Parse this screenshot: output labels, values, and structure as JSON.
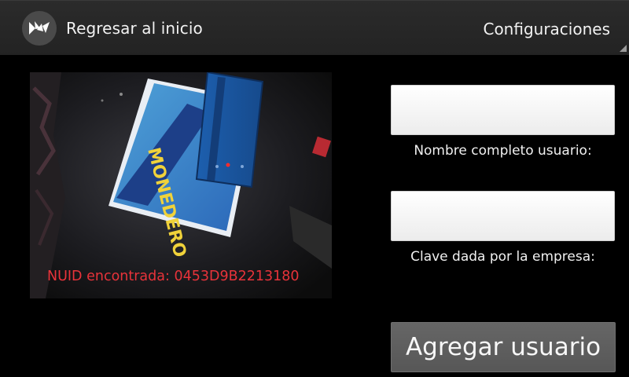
{
  "action_bar": {
    "title": "Regresar al inicio",
    "settings_label": "Configuraciones"
  },
  "camera": {
    "nuid_text": "NUID encontrada: 0453D9B2213180",
    "card_print_text": "MONEDERO",
    "nuid_color": "#e8333a"
  },
  "form": {
    "name_field": {
      "value": "",
      "placeholder": ""
    },
    "name_label": "Nombre completo usuario:",
    "key_field": {
      "value": "",
      "placeholder": ""
    },
    "key_label": "Clave dada por la empresa:",
    "submit_label": "Agregar usuario"
  },
  "colors": {
    "background": "#000000",
    "action_bar": "#2b2b2b",
    "button": "#5f5f5f",
    "field": "#f5f5f5"
  },
  "icons": {
    "logo": "kivy-logo-icon",
    "overflow_corner": "corner-triangle-icon"
  }
}
